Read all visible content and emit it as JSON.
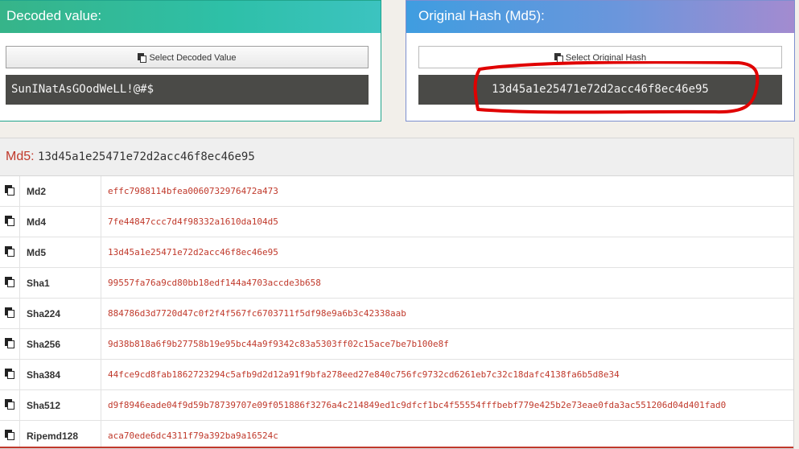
{
  "decoded_panel": {
    "title": "Decoded value:",
    "select_button": "Select Decoded Value",
    "value": "SunINatAsGOodWeLL!@#$"
  },
  "hash_panel": {
    "title": "Original Hash (Md5):",
    "select_button": "Select Original Hash",
    "value": "13d45a1e25471e72d2acc46f8ec46e95"
  },
  "results": {
    "label": "Md5:",
    "value": "13d45a1e25471e72d2acc46f8ec46e95",
    "rows": [
      {
        "name": "Md2",
        "hash": "effc7988114bfea0060732976472a473"
      },
      {
        "name": "Md4",
        "hash": "7fe44847ccc7d4f98332a1610da104d5"
      },
      {
        "name": "Md5",
        "hash": "13d45a1e25471e72d2acc46f8ec46e95"
      },
      {
        "name": "Sha1",
        "hash": "99557fa76a9cd80bb18edf144a4703accde3b658"
      },
      {
        "name": "Sha224",
        "hash": "884786d3d7720d47c0f2f4f567fc6703711f5df98e9a6b3c42338aab"
      },
      {
        "name": "Sha256",
        "hash": "9d38b818a6f9b27758b19e95bc44a9f9342c83a5303ff02c15ace7be7b100e8f"
      },
      {
        "name": "Sha384",
        "hash": "44fce9cd8fab1862723294c5afb9d2d12a91f9bfa278eed27e840c756fc9732cd6261eb7c32c18dafc4138fa6b5d8e34"
      },
      {
        "name": "Sha512",
        "hash": "d9f8946eade04f9d59b78739707e09f051886f3276a4c214849ed1c9dfcf1bc4f55554fffbebf779e425b2e73eae0fda3ac551206d04d401fad0"
      },
      {
        "name": "Ripemd128",
        "hash": "aca70ede6dc4311f79a392ba9a16524c"
      }
    ]
  },
  "colors": {
    "annotation": "#e00000",
    "hash_text": "#c0392b",
    "label": "#c0392b"
  }
}
